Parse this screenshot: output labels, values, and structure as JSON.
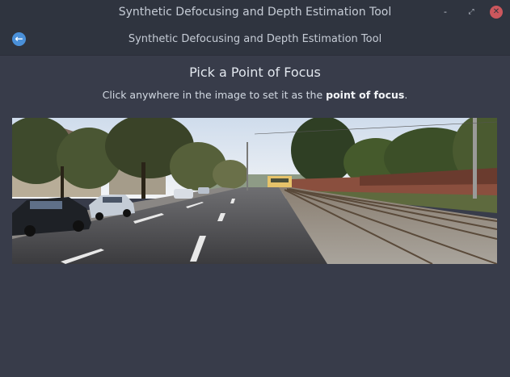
{
  "window": {
    "title": "Synthetic Defocusing and Depth Estimation Tool",
    "controls": {
      "minimize": "-",
      "maximize": "⤢",
      "close": "✕"
    }
  },
  "header": {
    "title": "Synthetic Defocusing and Depth Estimation Tool",
    "back_icon": "back-arrow-icon"
  },
  "main": {
    "heading": "Pick a Point of Focus",
    "instruction_prefix": "Click anywhere in the image to set it as the ",
    "instruction_bold": "point of focus",
    "instruction_suffix": ".",
    "image": {
      "subject": "street scene with road, parked cars, trees and railway tracks"
    }
  },
  "colors": {
    "window_bg": "#383c4a",
    "titlebar_bg": "#2f343f",
    "accent": "#4a90d9",
    "close": "#cc575d"
  }
}
